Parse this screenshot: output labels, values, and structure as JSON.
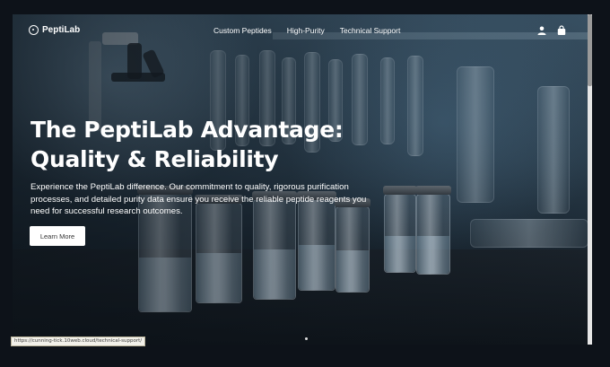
{
  "brand": {
    "name": "PeptiLab"
  },
  "nav": {
    "links": [
      "Custom Peptides",
      "High-Purity",
      "Technical Support"
    ],
    "icons": [
      "user-icon",
      "shopping-bag-icon"
    ]
  },
  "hero": {
    "title_line1": "The PeptiLab Advantage:",
    "title_line2": "Quality & Reliability",
    "description": "Experience the PeptiLab difference. Our commitment to quality, rigorous purification processes, and detailed purity data ensure you receive the reliable peptide reagents you need for successful research outcomes.",
    "cta_label": "Learn More"
  },
  "status_bar": {
    "url": "https://cunning-tick.10web.cloud/technical-support/"
  },
  "colors": {
    "page_bg": "#0d1219",
    "text": "#ffffff",
    "button_bg": "#ffffff"
  }
}
